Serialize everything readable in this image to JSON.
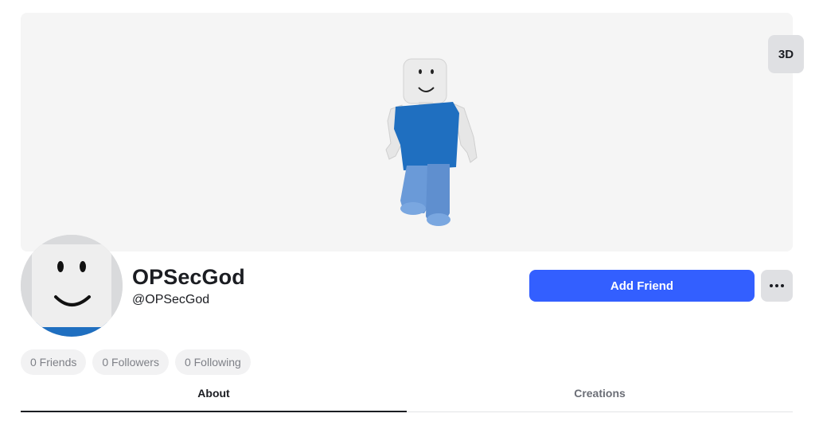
{
  "stage": {
    "view_toggle_label": "3D"
  },
  "profile": {
    "display_name": "OPSecGod",
    "username": "@OPSecGod",
    "add_friend_label": "Add Friend",
    "more_label": "..."
  },
  "social": {
    "friends": "0 Friends",
    "followers": "0 Followers",
    "following": "0 Following"
  },
  "tabs": [
    {
      "label": "About",
      "active": true
    },
    {
      "label": "Creations",
      "active": false
    }
  ],
  "colors": {
    "accent": "#335fff",
    "stage_bg": "#f5f5f5",
    "shirt": "#1f6fc0",
    "pants": "#6a9ad8",
    "skin": "#e8e8e8"
  },
  "icons": {
    "more": "ellipsis-icon"
  }
}
